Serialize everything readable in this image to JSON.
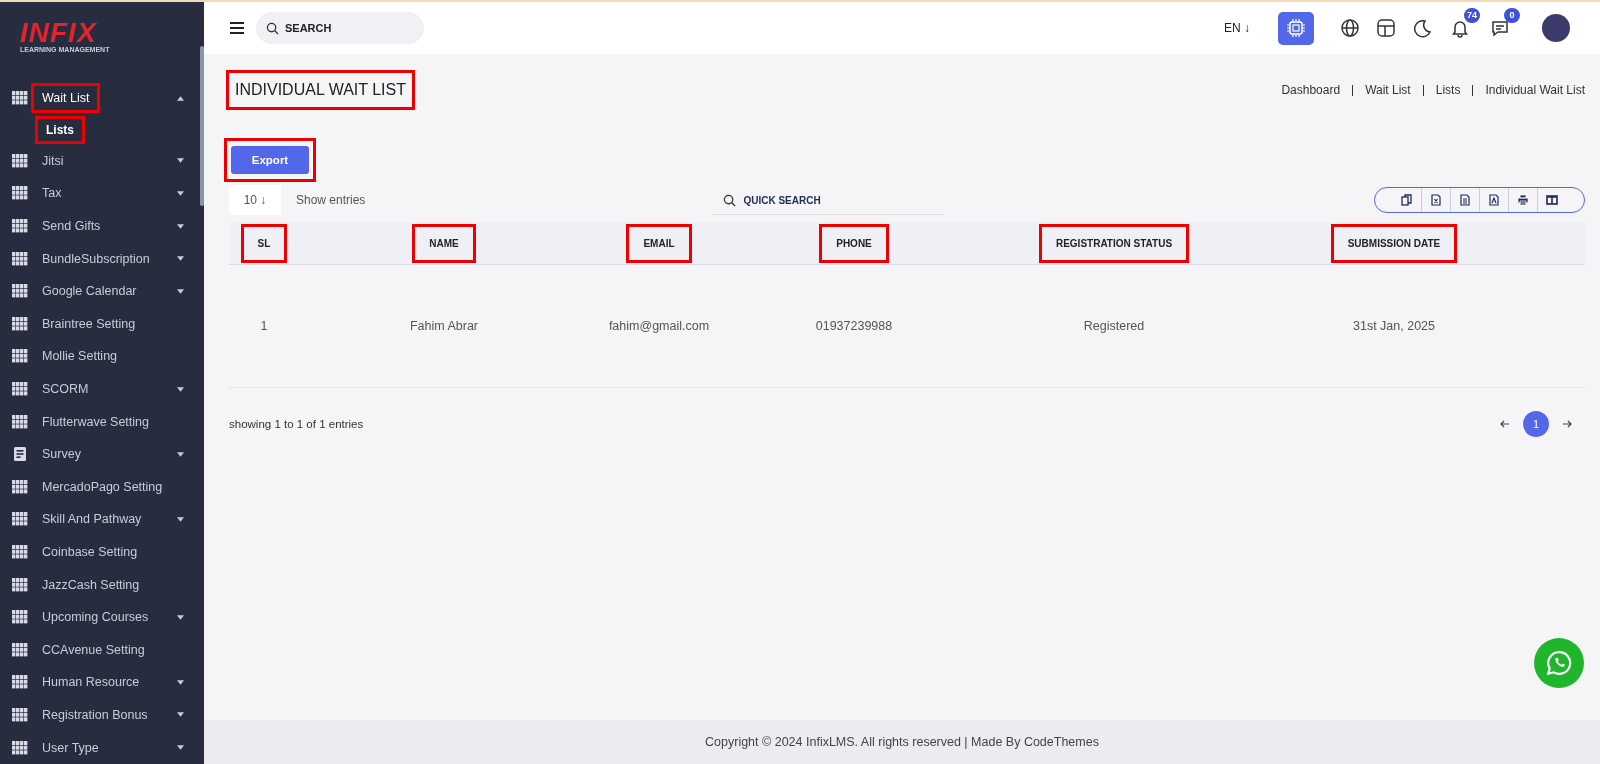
{
  "sidebar": {
    "logo": {
      "brand": "INFIX",
      "subtitle": "LEARNING MANAGEMENT"
    },
    "items": [
      {
        "label": "Wait List",
        "kind": "grid",
        "expandable": true,
        "expanded": true,
        "highlighted": true,
        "children": [
          {
            "label": "Lists",
            "highlighted": true
          }
        ]
      },
      {
        "label": "Jitsi",
        "kind": "grid",
        "expandable": true,
        "expanded": false,
        "highlighted": false
      },
      {
        "label": "Tax",
        "kind": "grid",
        "expandable": true,
        "expanded": false,
        "highlighted": false
      },
      {
        "label": "Send Gifts",
        "kind": "grid",
        "expandable": true,
        "expanded": false,
        "highlighted": false
      },
      {
        "label": "BundleSubscription",
        "kind": "grid",
        "expandable": true,
        "expanded": false,
        "highlighted": false
      },
      {
        "label": "Google Calendar",
        "kind": "grid",
        "expandable": true,
        "expanded": false,
        "highlighted": false
      },
      {
        "label": "Braintree Setting",
        "kind": "grid",
        "expandable": false,
        "expanded": false,
        "highlighted": false
      },
      {
        "label": "Mollie Setting",
        "kind": "grid",
        "expandable": false,
        "expanded": false,
        "highlighted": false
      },
      {
        "label": "SCORM",
        "kind": "grid",
        "expandable": true,
        "expanded": false,
        "highlighted": false
      },
      {
        "label": "Flutterwave Setting",
        "kind": "grid",
        "expandable": false,
        "expanded": false,
        "highlighted": false
      },
      {
        "label": "Survey",
        "kind": "form",
        "expandable": true,
        "expanded": false,
        "highlighted": false
      },
      {
        "label": "MercadoPago Setting",
        "kind": "grid",
        "expandable": false,
        "expanded": false,
        "highlighted": false
      },
      {
        "label": "Skill And Pathway",
        "kind": "grid",
        "expandable": true,
        "expanded": false,
        "highlighted": false
      },
      {
        "label": "Coinbase Setting",
        "kind": "grid",
        "expandable": false,
        "expanded": false,
        "highlighted": false
      },
      {
        "label": "JazzCash Setting",
        "kind": "grid",
        "expandable": false,
        "expanded": false,
        "highlighted": false
      },
      {
        "label": "Upcoming Courses",
        "kind": "grid",
        "expandable": true,
        "expanded": false,
        "highlighted": false
      },
      {
        "label": "CCAvenue Setting",
        "kind": "grid",
        "expandable": false,
        "expanded": false,
        "highlighted": false
      },
      {
        "label": "Human Resource",
        "kind": "grid",
        "expandable": true,
        "expanded": false,
        "highlighted": false
      },
      {
        "label": "Registration Bonus",
        "kind": "grid",
        "expandable": true,
        "expanded": false,
        "highlighted": false
      },
      {
        "label": "User Type",
        "kind": "grid",
        "expandable": true,
        "expanded": false,
        "highlighted": false
      }
    ]
  },
  "header": {
    "search": {
      "placeholder": "SEARCH"
    },
    "language": "EN ↓",
    "notifications_count": "74",
    "messages_count": "0"
  },
  "page": {
    "title": "INDIVIDUAL WAIT LIST",
    "title_highlighted": true,
    "breadcrumb": [
      "Dashboard",
      "Wait List",
      "Lists",
      "Individual Wait List"
    ],
    "export_button": {
      "label": "Export",
      "highlighted": true
    },
    "entries": {
      "value": "10 ↓",
      "label": "Show entries"
    },
    "quick_search": {
      "placeholder": "QUICK SEARCH"
    },
    "table": {
      "columns": [
        {
          "label": "SL",
          "highlighted": true
        },
        {
          "label": "NAME",
          "highlighted": true
        },
        {
          "label": "EMAIL",
          "highlighted": true
        },
        {
          "label": "PHONE",
          "highlighted": true
        },
        {
          "label": "REGISTRATION STATUS",
          "highlighted": true
        },
        {
          "label": "SUBMISSION DATE",
          "highlighted": true
        }
      ],
      "rows": [
        [
          "1",
          "Fahim Abrar",
          "fahim@gmail.com",
          "01937239988",
          "Registered",
          "31st Jan, 2025"
        ]
      ]
    },
    "showing": "showing 1 to 1 of 1 entries",
    "pages": [
      {
        "label": "1",
        "selected": true
      }
    ]
  },
  "footer": "Copyright © 2024 InfixLMS. All rights reserved | Made By CodeThemes"
}
